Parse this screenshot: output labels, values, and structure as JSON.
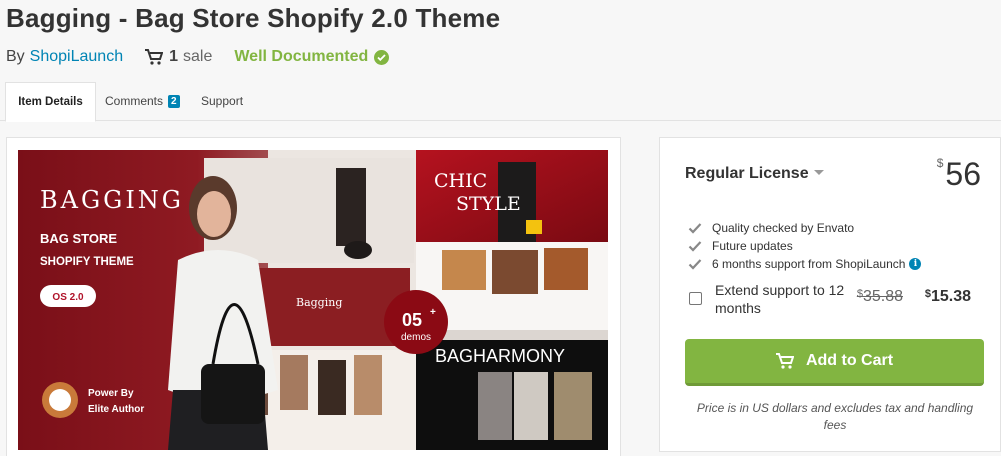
{
  "header": {
    "title": "Bagging - Bag Store Shopify 2.0 Theme",
    "by_label": "By",
    "author": "ShopiLaunch",
    "sales_count": "1",
    "sales_label": "sale",
    "doc_label": "Well Documented"
  },
  "tabs": {
    "item_details": "Item Details",
    "comments": "Comments",
    "comments_count": "2",
    "support": "Support"
  },
  "preview": {
    "brand": "BAGGING",
    "line1": "BAG STORE",
    "line2": "SHOPIFY THEME",
    "os_badge": "OS 2.0",
    "power_by": "Power By",
    "elite": "Elite Author",
    "chic1": "CHIC",
    "chic2": "STYLE",
    "demos_number": "05",
    "demos_plus": "+",
    "demos_label": "demos",
    "harmony": "BAGHARMONY",
    "mini_brand": "Bagging"
  },
  "license": {
    "title": "Regular License",
    "currency": "$",
    "price": "56",
    "features": [
      "Quality checked by Envato",
      "Future updates",
      "6 months support from ShopiLaunch"
    ],
    "extend_label": "Extend support to 12 months",
    "old_price": "35.88",
    "new_price": "15.38",
    "add_to_cart": "Add to Cart",
    "note": "Price is in US dollars and excludes tax and handling fees"
  },
  "colors": {
    "accent_green": "#82b541",
    "link_blue": "#0084b4",
    "banner_red": "#6b0e16"
  }
}
